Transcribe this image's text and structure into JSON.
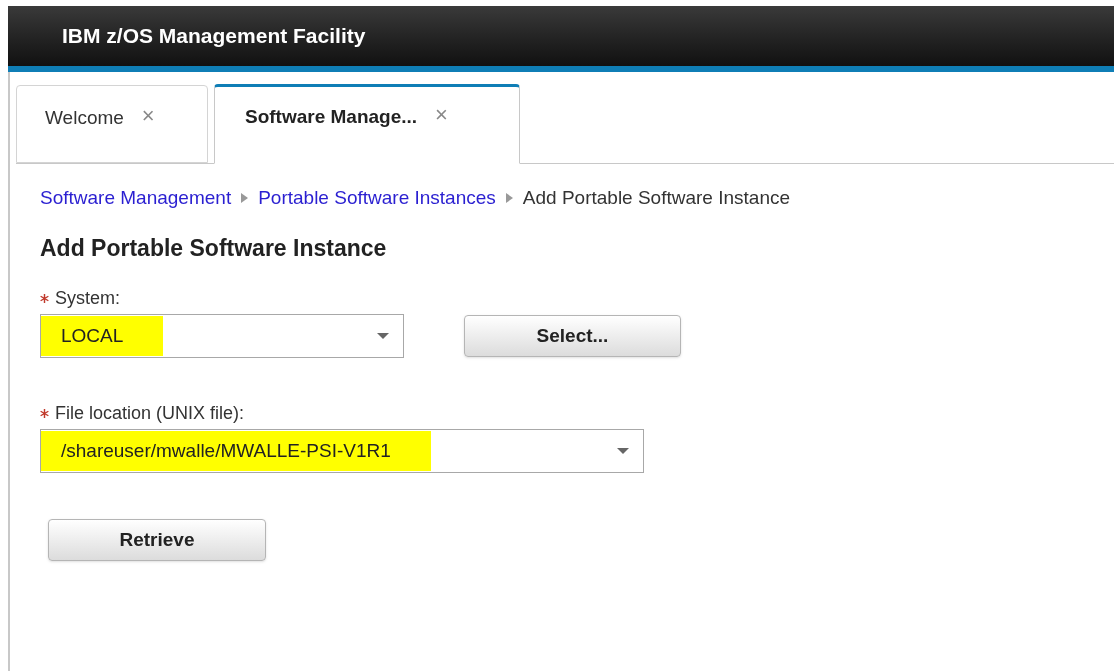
{
  "header": {
    "title": "IBM z/OS Management Facility"
  },
  "tabs": [
    {
      "label": "Welcome",
      "close": "×",
      "selected": false
    },
    {
      "label": "Software Manage...",
      "close": "×",
      "selected": true
    }
  ],
  "breadcrumb": [
    {
      "label": "Software Management",
      "kind": "link"
    },
    {
      "label": "Portable Software Instances",
      "kind": "link"
    },
    {
      "label": "Add Portable Software Instance",
      "kind": "current"
    }
  ],
  "page_title": "Add Portable Software Instance",
  "fields": [
    {
      "label": "System:",
      "required": true,
      "value": "LOCAL",
      "highlighted": true,
      "button": "Select..."
    },
    {
      "label": "File location (UNIX file):",
      "required": true,
      "value": "/shareuser/mwalle/MWALLE-PSI-V1R1",
      "highlighted": true
    }
  ],
  "buttons": [
    "Retrieve"
  ]
}
